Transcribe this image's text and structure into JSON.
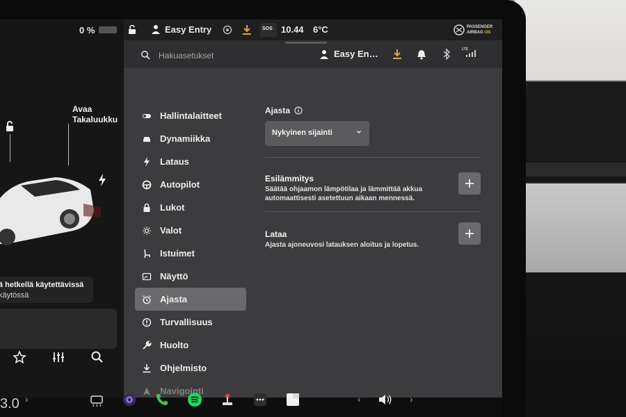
{
  "status_bar": {
    "battery_percent": "0 %",
    "profile": "Easy Entry",
    "sos_label": "SOS",
    "time": "10.44",
    "temperature": "6°C",
    "airbag_line1": "PASSENGER",
    "airbag_line2": "AIRBAG",
    "airbag_state": "ON"
  },
  "car_panel": {
    "trunk_label_line1": "Avaa",
    "trunk_label_line2": "Takaluukku",
    "notice_line1": "ä hetkellä käytettävissä",
    "notice_line2": "käytössä"
  },
  "settings_header": {
    "search_placeholder": "Hakuasetukset",
    "user_name": "Easy En…",
    "signal_label": "LTE"
  },
  "nav": {
    "items": [
      {
        "label": "Hallintalaitteet",
        "icon": "toggle-icon"
      },
      {
        "label": "Dynamiikka",
        "icon": "car-icon"
      },
      {
        "label": "Lataus",
        "icon": "bolt-icon"
      },
      {
        "label": "Autopilot",
        "icon": "steering-wheel-icon"
      },
      {
        "label": "Lukot",
        "icon": "lock-icon"
      },
      {
        "label": "Valot",
        "icon": "sun-icon"
      },
      {
        "label": "Istuimet",
        "icon": "seat-icon"
      },
      {
        "label": "Näyttö",
        "icon": "display-icon"
      },
      {
        "label": "Ajasta",
        "icon": "alarm-clock-icon"
      },
      {
        "label": "Turvallisuus",
        "icon": "alert-icon"
      },
      {
        "label": "Huolto",
        "icon": "wrench-icon"
      },
      {
        "label": "Ohjelmisto",
        "icon": "download-icon"
      },
      {
        "label": "Navigointi",
        "icon": "navigation-icon"
      }
    ],
    "active_index": 8
  },
  "content": {
    "title": "Ajasta",
    "location_dropdown": "Nykyinen sijainti",
    "sections": [
      {
        "title": "Esilämmitys",
        "description": "Säätää ohjaamon lämpötilaa ja lämmittää akkua automaattisesti asetettuun aikaan mennessä."
      },
      {
        "title": "Lataa",
        "description": "Ajasta ajoneuvosi latauksen aloitus ja lopetus."
      }
    ]
  },
  "dock": {
    "temperature_fragment": "3.0",
    "icons": [
      "rear-defrost-icon",
      "camera-icon",
      "phone-icon",
      "spotify-icon",
      "joystick-icon",
      "more-icon",
      "card-icon",
      "volume-icon"
    ]
  },
  "colors": {
    "accent_orange": "#e0a63b",
    "phone_green": "#3cc45a",
    "spotify_green": "#1ed760",
    "settings_bg": "#3c3c3e",
    "active_nav": "#6a6a6d"
  }
}
